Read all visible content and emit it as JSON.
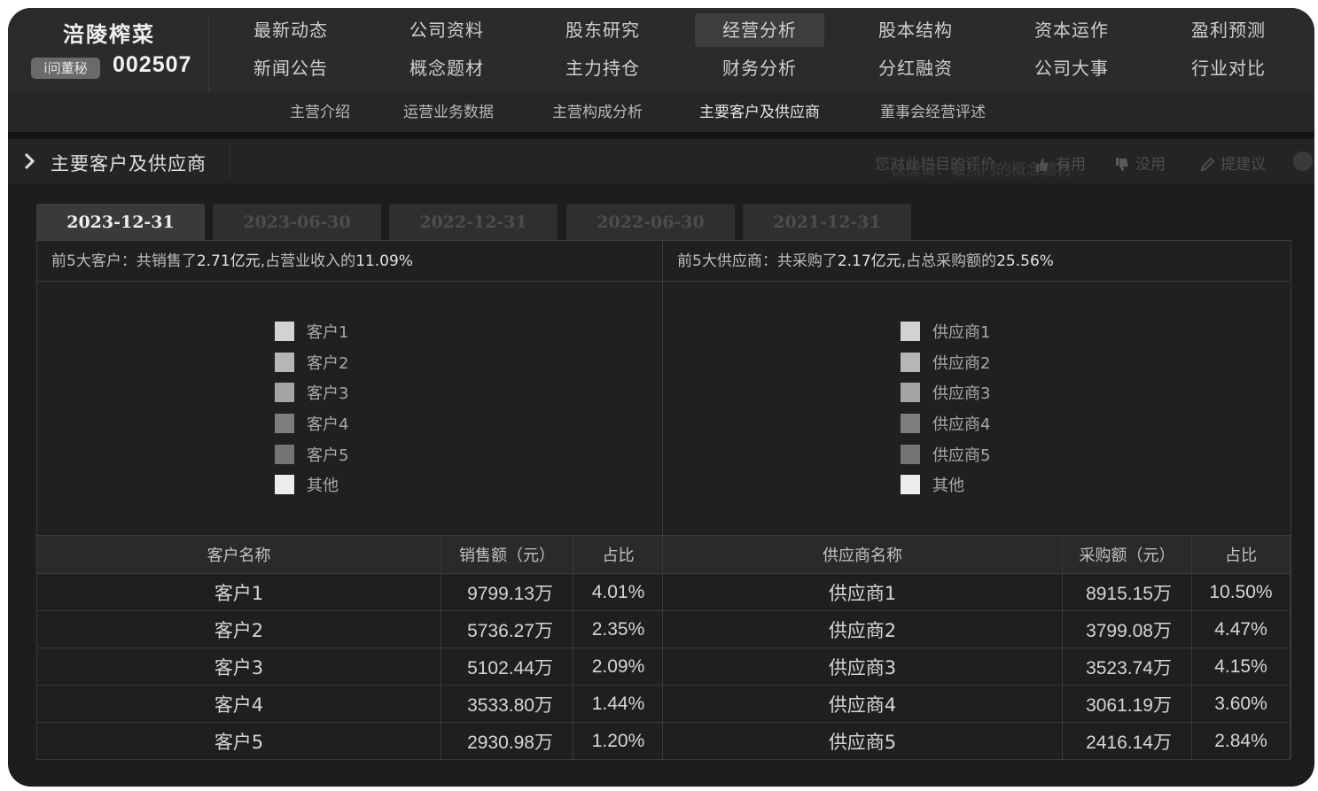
{
  "header": {
    "company_name": "涪陵榨菜",
    "ask_secretary": "i问董秘",
    "stock_code": "002507",
    "nav_row1": [
      "最新动态",
      "公司资料",
      "股东研究",
      "经营分析",
      "股本结构",
      "资本运作",
      "盈利预测"
    ],
    "nav_row2": [
      "新闻公告",
      "概念题材",
      "主力持仓",
      "财务分析",
      "分红融资",
      "公司大事",
      "行业对比"
    ],
    "active_nav": "经营分析",
    "sub_nav": [
      "主营介绍",
      "运营业务数据",
      "主营构成分析",
      "主要客户及供应商",
      "董事会经营评述"
    ],
    "active_sub_nav": "主要客户及供应商"
  },
  "section": {
    "title": "主要客户及供应商",
    "feedback_prompt": "您对此栏目的评价",
    "feedback_overlay": "快捷键：最热门的概念题材",
    "useful": "有用",
    "useless": "没用",
    "suggest": "提建议"
  },
  "date_tabs": [
    "2023-12-31",
    "2023-06-30",
    "2022-12-31",
    "2022-06-30",
    "2021-12-31"
  ],
  "active_date": "2023-12-31",
  "customers": {
    "summary_prefix": "前5大客户：共销售了",
    "summary_amount": "2.71亿元",
    "summary_mid": ",占营业收入的",
    "summary_pct": "11.09%",
    "legend": [
      {
        "label": "客户1",
        "color": "#d2d2d2"
      },
      {
        "label": "客户2",
        "color": "#b6b6b6"
      },
      {
        "label": "客户3",
        "color": "#a4a4a4"
      },
      {
        "label": "客户4",
        "color": "#7e7e7e"
      },
      {
        "label": "客户5",
        "color": "#747474"
      },
      {
        "label": "其他",
        "color": "#ececec"
      }
    ],
    "columns": [
      "客户名称",
      "销售额（元）",
      "占比"
    ],
    "rows": [
      [
        "客户1",
        "9799.13万",
        "4.01%"
      ],
      [
        "客户2",
        "5736.27万",
        "2.35%"
      ],
      [
        "客户3",
        "5102.44万",
        "2.09%"
      ],
      [
        "客户4",
        "3533.80万",
        "1.44%"
      ],
      [
        "客户5",
        "2930.98万",
        "1.20%"
      ]
    ]
  },
  "suppliers": {
    "summary_prefix": "前5大供应商：共采购了",
    "summary_amount": "2.17亿元",
    "summary_mid": ",占总采购额的",
    "summary_pct": "25.56%",
    "legend": [
      {
        "label": "供应商1",
        "color": "#d2d2d2"
      },
      {
        "label": "供应商2",
        "color": "#b6b6b6"
      },
      {
        "label": "供应商3",
        "color": "#a4a4a4"
      },
      {
        "label": "供应商4",
        "color": "#7e7e7e"
      },
      {
        "label": "供应商5",
        "color": "#747474"
      },
      {
        "label": "其他",
        "color": "#ececec"
      }
    ],
    "columns": [
      "供应商名称",
      "采购额（元）",
      "占比"
    ],
    "rows": [
      [
        "供应商1",
        "8915.15万",
        "10.50%"
      ],
      [
        "供应商2",
        "3799.08万",
        "4.47%"
      ],
      [
        "供应商3",
        "3523.74万",
        "4.15%"
      ],
      [
        "供应商4",
        "3061.19万",
        "3.60%"
      ],
      [
        "供应商5",
        "2416.14万",
        "2.84%"
      ]
    ]
  }
}
